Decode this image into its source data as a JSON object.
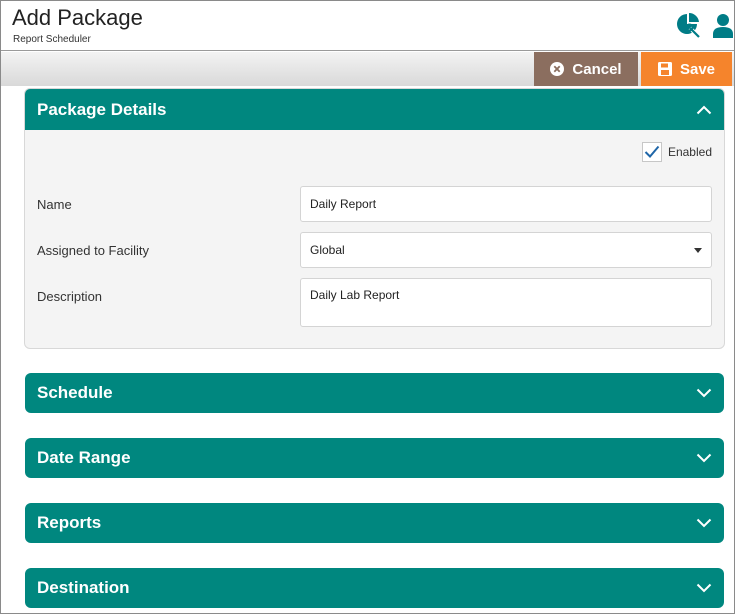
{
  "header": {
    "title": "Add Package",
    "subtitle": "Report Scheduler",
    "icons": [
      "tools-chart-icon",
      "user-icon"
    ]
  },
  "toolbar": {
    "cancel_label": "Cancel",
    "save_label": "Save"
  },
  "package_details": {
    "title": "Package Details",
    "enabled_label": "Enabled",
    "enabled_checked": true,
    "fields": {
      "name": {
        "label": "Name",
        "value": "Daily Report"
      },
      "facility": {
        "label": "Assigned to Facility",
        "value": "Global"
      },
      "description": {
        "label": "Description",
        "value": "Daily Lab Report"
      }
    }
  },
  "sections": [
    {
      "title": "Schedule"
    },
    {
      "title": "Date Range"
    },
    {
      "title": "Reports"
    },
    {
      "title": "Destination"
    }
  ],
  "colors": {
    "accent": "#00877f",
    "cancel": "#8b6e5f",
    "save": "#f5842c",
    "icon": "#007c86"
  }
}
